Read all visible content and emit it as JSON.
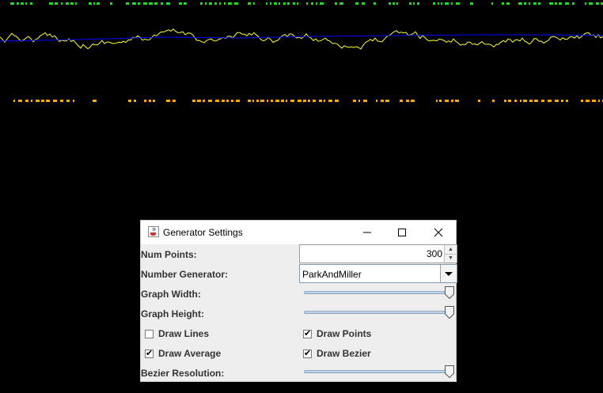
{
  "colors": {
    "background": "#000000",
    "graph_line": "#ffff33",
    "average_line": "#0000ff",
    "top_points": "#22dd22",
    "bottom_points": "#ffaa00"
  },
  "dialog": {
    "title": "Generator Settings",
    "icons": {
      "app": "java-cup-icon",
      "minimize": "minimize-icon",
      "maximize": "maximize-icon",
      "close": "close-icon"
    },
    "num_points": {
      "label": "Num Points:",
      "value": "300"
    },
    "number_generator": {
      "label": "Number Generator:",
      "value": "ParkAndMiller"
    },
    "graph_width": {
      "label": "Graph Width:",
      "level": 1.0
    },
    "graph_height": {
      "label": "Graph Height:",
      "level": 1.0
    },
    "draw_lines": {
      "label": "Draw Lines",
      "checked": false
    },
    "draw_points": {
      "label": "Draw Points",
      "checked": true
    },
    "draw_average": {
      "label": "Draw Average",
      "checked": true
    },
    "draw_bezier": {
      "label": "Draw Bezier",
      "checked": true
    },
    "bezier_resolution": {
      "label": "Bezier Resolution:",
      "level": 1.0
    }
  }
}
